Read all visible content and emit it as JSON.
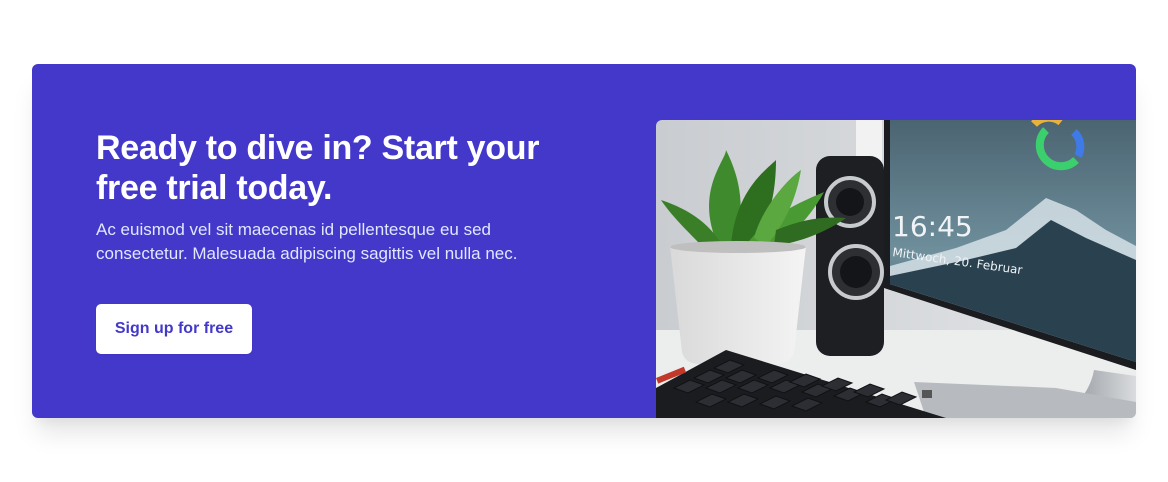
{
  "cta": {
    "headline_line1": "Ready to dive in? Start your",
    "headline_line2": "free trial today.",
    "body_line1": "Ac euismod vel sit maecenas id pellentesque eu sed",
    "body_line2": "consectetur. Malesuada adipiscing sagittis vel nulla nec.",
    "button_label": "Sign up for free"
  },
  "screenshot_image": {
    "subject": "desk-with-monitor-keyboard-plant-speaker",
    "clock_time": "16:45",
    "clock_date": "Mittwoch, 20. Februar"
  },
  "colors": {
    "panel_bg": "#4338ca",
    "headline": "#ffffff",
    "body_text": "#e0e7ff",
    "button_bg": "#ffffff",
    "button_text": "#4338ca"
  }
}
